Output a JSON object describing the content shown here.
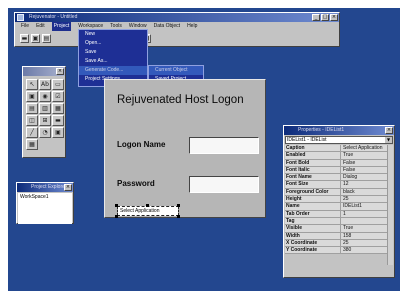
{
  "main_window": {
    "title": "Rejuvenator - Untitled",
    "menus": [
      "File",
      "Edit",
      "Project",
      "Workspace",
      "Tools",
      "Window",
      "Data Object",
      "Help"
    ],
    "selected_menu": "Project",
    "controls": [
      "_",
      "□",
      "×"
    ]
  },
  "toolbar": {
    "buttons": [
      "▬",
      "▣",
      "▤",
      "▦",
      "■",
      "▸",
      "■"
    ]
  },
  "project_menu": {
    "items": [
      "New",
      "Open...",
      "Save",
      "Save As...",
      "Generate Code...",
      "Project Settings"
    ],
    "highlighted": "Generate Code..."
  },
  "submenu": {
    "items": [
      "Current Object",
      "Saved Project"
    ]
  },
  "toolbox": {
    "title": "",
    "tools": [
      "↖",
      "Ab",
      "▭",
      "▣",
      "◉",
      "☑",
      "▤",
      "▥",
      "▦",
      "◫",
      "⊞",
      "▬",
      "╱",
      "◔",
      "▣",
      "▦"
    ]
  },
  "form": {
    "title": "Rejuvenated Host Logon",
    "logon_label": "Logon Name",
    "password_label": "Password",
    "select_control": "Select Application"
  },
  "project_window": {
    "title": "Project Explorer",
    "item": "WorkSpace1"
  },
  "properties": {
    "title": "Properties - IDEList1",
    "object": "IDEList1 - IDEList",
    "rows": [
      {
        "k": "Caption",
        "v": "Select Application"
      },
      {
        "k": "Enabled",
        "v": "True"
      },
      {
        "k": "Font Bold",
        "v": "False"
      },
      {
        "k": "Font Italic",
        "v": "False"
      },
      {
        "k": "Font Name",
        "v": "Dialog"
      },
      {
        "k": "Font Size",
        "v": "12"
      },
      {
        "k": "Foreground Color",
        "v": "black"
      },
      {
        "k": "Height",
        "v": "25"
      },
      {
        "k": "Name",
        "v": "IDEList1"
      },
      {
        "k": "Tab Order",
        "v": "1"
      },
      {
        "k": "Tag",
        "v": ""
      },
      {
        "k": "Visible",
        "v": "True"
      },
      {
        "k": "Width",
        "v": "158"
      },
      {
        "k": "X Coordinate",
        "v": "25"
      },
      {
        "k": "Y Coordinate",
        "v": "380"
      }
    ]
  },
  "colors": {
    "desktop": "#23478f",
    "menu": "#1e2f95",
    "form": "#b6b6b6"
  }
}
